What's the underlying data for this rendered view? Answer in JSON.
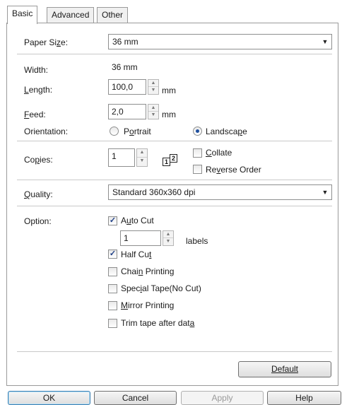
{
  "tabs": [
    {
      "label": "Basic",
      "active": true
    },
    {
      "label": "Advanced",
      "active": false
    },
    {
      "label": "Other",
      "active": false
    }
  ],
  "paper_size": {
    "label": "Paper Size:",
    "value": "36 mm"
  },
  "width": {
    "label": "Width:",
    "value": "36 mm"
  },
  "length": {
    "label": "Length:",
    "value": "100,0",
    "unit": "mm"
  },
  "feed": {
    "label": "Feed:",
    "value": "2,0",
    "unit": "mm"
  },
  "orientation": {
    "label": "Orientation:",
    "options": [
      {
        "label": "Portrait",
        "selected": false
      },
      {
        "label": "Landscape",
        "selected": true
      }
    ]
  },
  "copies": {
    "label": "Copies:",
    "value": "1",
    "icon_page_1": "1",
    "icon_page_2": "2",
    "collate": {
      "label": "Collate",
      "checked": false
    },
    "reverse_order": {
      "label": "Reverse Order",
      "checked": false
    }
  },
  "quality": {
    "label": "Quality:",
    "value": "Standard 360x360 dpi"
  },
  "option": {
    "label": "Option:",
    "auto_cut": {
      "label": "Auto Cut",
      "checked": true
    },
    "cut_every": {
      "value": "1",
      "unit": "labels"
    },
    "half_cut": {
      "label": "Half Cut",
      "checked": true
    },
    "chain_printing": {
      "label": "Chain Printing",
      "checked": false
    },
    "special_tape": {
      "label": "Special Tape(No Cut)",
      "checked": false
    },
    "mirror_printing": {
      "label": "Mirror Printing",
      "checked": false
    },
    "trim_tape": {
      "label": "Trim tape after data",
      "checked": false
    }
  },
  "buttons": {
    "default": "Default",
    "ok": "OK",
    "cancel": "Cancel",
    "apply": "Apply",
    "help": "Help"
  },
  "icons": {
    "dropdown": "chevron-down-icon",
    "spin": "spin-up-down-icon",
    "check": "checkmark-icon",
    "copies": "collate-pages-icon"
  }
}
